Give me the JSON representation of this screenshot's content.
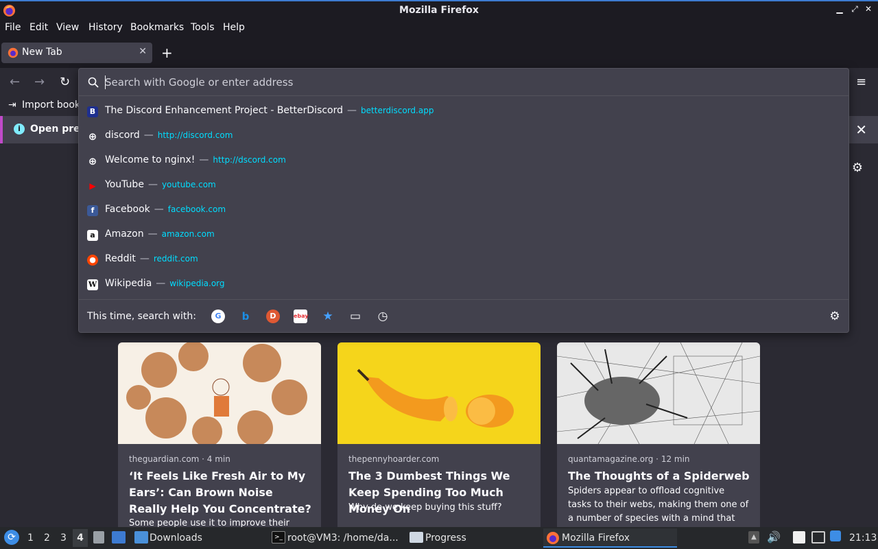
{
  "window": {
    "title": "Mozilla Firefox"
  },
  "menu": [
    "File",
    "Edit",
    "View",
    "History",
    "Bookmarks",
    "Tools",
    "Help"
  ],
  "tab": {
    "label": "New Tab"
  },
  "bookmarks": {
    "import_label": "Import book"
  },
  "infobar": {
    "text": "Open pre"
  },
  "urlbar": {
    "placeholder": "Search with Google or enter address"
  },
  "suggestions": [
    {
      "title": "The Discord Enhancement Project - BetterDiscord",
      "sep": "—",
      "url": "betterdiscord.app"
    },
    {
      "title": "discord",
      "sep": "—",
      "url": "http://discord.com"
    },
    {
      "title": "Welcome to nginx!",
      "sep": "—",
      "url": "http://dscord.com"
    },
    {
      "title": "YouTube",
      "sep": "—",
      "url": "youtube.com"
    },
    {
      "title": "Facebook",
      "sep": "—",
      "url": "facebook.com"
    },
    {
      "title": "Amazon",
      "sep": "—",
      "url": "amazon.com"
    },
    {
      "title": "Reddit",
      "sep": "—",
      "url": "reddit.com"
    },
    {
      "title": "Wikipedia",
      "sep": "—",
      "url": "wikipedia.org"
    }
  ],
  "oneoff": {
    "label": "This time, search with:"
  },
  "cards": [
    {
      "source": "theguardian.com · 4 min",
      "headline": "‘It Feels Like Fresh Air to My Ears’: Can Brown Noise Really Help You Concentrate?",
      "excerpt": "Some people use it to improve their"
    },
    {
      "source": "thepennyhoarder.com",
      "headline": "The 3 Dumbest Things We Keep Spending Too Much Money On",
      "excerpt": "Why do we keep buying this stuff?"
    },
    {
      "source": "quantamagazine.org · 12 min",
      "headline": "The Thoughts of a Spiderweb",
      "excerpt": "Spiders appear to offload cognitive tasks to their webs, making them one of a number of species with a mind that isn’..."
    }
  ],
  "taskbar": {
    "workspaces": [
      "1",
      "2",
      "3",
      "4"
    ],
    "downloads": "Downloads",
    "terminal": "root@VM3: /home/da...",
    "progress": "Progress",
    "firefox": "Mozilla Firefox",
    "clock": "21:13"
  }
}
